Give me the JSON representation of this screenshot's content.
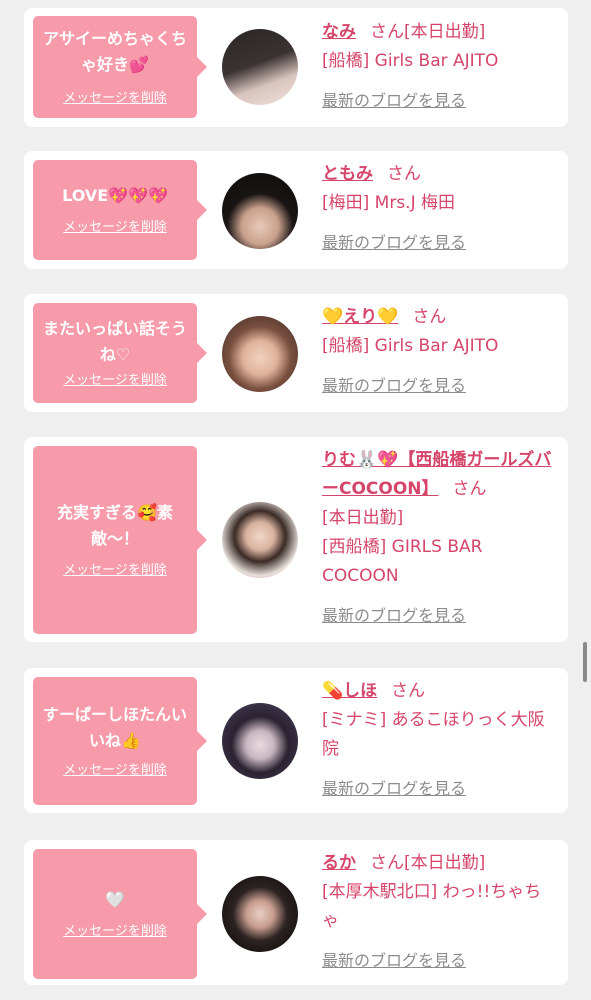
{
  "delete_label": "メッセージを削除",
  "blog_label": "最新のブログを見る",
  "cards": [
    {
      "message": "アサイーめちゃくちゃ好き💕",
      "name": "なみ",
      "san": "さん",
      "status": "[本日出勤]",
      "shop": "[船橋] Girls Bar AJITO"
    },
    {
      "message": "LOVE💖💖💖",
      "name": "ともみ",
      "san": "さん",
      "shop": "[梅田] Mrs.J 梅田"
    },
    {
      "message": "またいっぱい話そうね♡",
      "name": "💛えり💛",
      "san": "さん",
      "shop": "[船橋] Girls Bar AJITO"
    },
    {
      "message": "充実すぎる🥰素敵〜！",
      "name": "りむ🐰💖【西船橋ガールズバーCOCOON】",
      "san": "さん",
      "status": "[本日出勤]",
      "shop": "[西船橋] GIRLS BAR COCOON"
    },
    {
      "message": "すーぱーしほたんいいね👍",
      "name": "💊しほ",
      "san": "さん",
      "shop": "[ミナミ] あるこほりっく大阪院"
    },
    {
      "message": "🤍",
      "name": "るか",
      "san": "さん",
      "status": "[本日出勤]",
      "shop": "[本厚木駅北口] わっ!!ちゃちゃ"
    }
  ],
  "colors": {
    "bubble": "#f79aa9",
    "name": "#d6456a",
    "blog_link": "#8c8c8c",
    "background": "#efefef"
  }
}
